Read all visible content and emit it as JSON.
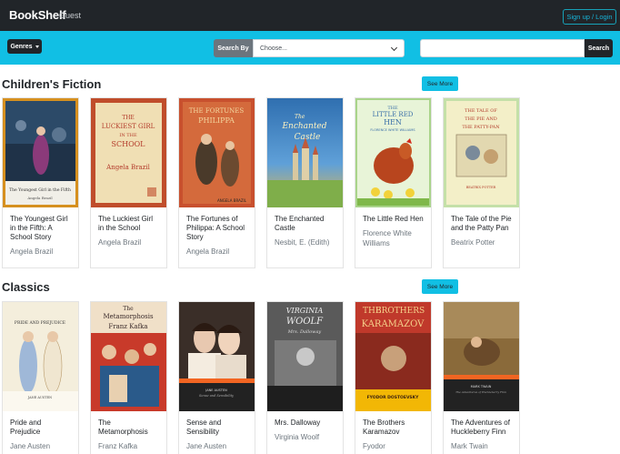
{
  "navbar": {
    "brand": "BookShelf",
    "user": "Guest",
    "signup_label": "Sign up / Login"
  },
  "searchbar": {
    "genres_label": "Genres",
    "search_by_label": "Search By",
    "select_value": "Choose...",
    "search_placeholder": "",
    "search_button_label": "Search"
  },
  "colors": {
    "navbar": "#212529",
    "accent": "#11bfe4"
  },
  "sections": [
    {
      "title": "Children's Fiction",
      "see_more_label": "See More",
      "books": [
        {
          "title": "The Youngest Girl in the Fifth: A School Story",
          "author": "Angela Brazil",
          "cover_text": [
            "The Youngest Girl in the Fifth",
            "Angela Brazil"
          ]
        },
        {
          "title": "The Luckiest Girl in the School",
          "author": "Angela Brazil",
          "cover_text": [
            "THE",
            "LUCKIEST GIRL",
            "IN THE",
            "SCHOOL",
            "Angela Brazil"
          ]
        },
        {
          "title": "The Fortunes of Philippa: A School Story",
          "author": "Angela Brazil",
          "cover_text": [
            "THE FORTUNES",
            "PHILIPPA",
            "ANGELA BRAZIL"
          ]
        },
        {
          "title": "The Enchanted Castle",
          "author": "Nesbit, E. (Edith)",
          "cover_text": [
            "The",
            "Enchanted",
            "Castle"
          ]
        },
        {
          "title": "The Little Red Hen",
          "author": "Florence White Williams",
          "cover_text": [
            "THE",
            "LITTLE RED",
            "HEN",
            "FLORENCE WHITE WILLIAMS"
          ]
        },
        {
          "title": "The Tale of the Pie and the Patty Pan",
          "author": "Beatrix Potter",
          "cover_text": [
            "THE TALE OF",
            "THE PIE AND",
            "THE PATTY-PAN",
            "BEATRIX POTTER"
          ]
        }
      ]
    },
    {
      "title": "Classics",
      "see_more_label": "See More",
      "books": [
        {
          "title": "Pride and Prejudice",
          "author": "Jane Austen",
          "cover_text": [
            "PRIDE AND PREJUDICE",
            "JANE AUSTEN"
          ]
        },
        {
          "title": "The Metamorphosis",
          "author": "Franz Kafka",
          "cover_text": [
            "The",
            "Metamorphosis",
            "Franz Kafka"
          ]
        },
        {
          "title": "Sense and Sensibility",
          "author": "Jane Austen",
          "cover_text": [
            "JANE AUSTEN",
            "Sense and Sensibility"
          ]
        },
        {
          "title": "Mrs. Dalloway",
          "author": "Virginia Woolf",
          "cover_text": [
            "VIRGINIA",
            "WOOLF",
            "Mrs. Dalloway"
          ]
        },
        {
          "title": "The Brothers Karamazov",
          "author": "Fyodor",
          "cover_text": [
            "THE",
            "BROTHERS",
            "KARAMAZOV",
            "FYODOR DOSTOEVSKY"
          ]
        },
        {
          "title": "The Adventures of Huckleberry Finn",
          "author": "Mark Twain",
          "cover_text": [
            "MARK TWAIN",
            "The Adventures of Huckleberry Finn"
          ]
        }
      ]
    }
  ]
}
